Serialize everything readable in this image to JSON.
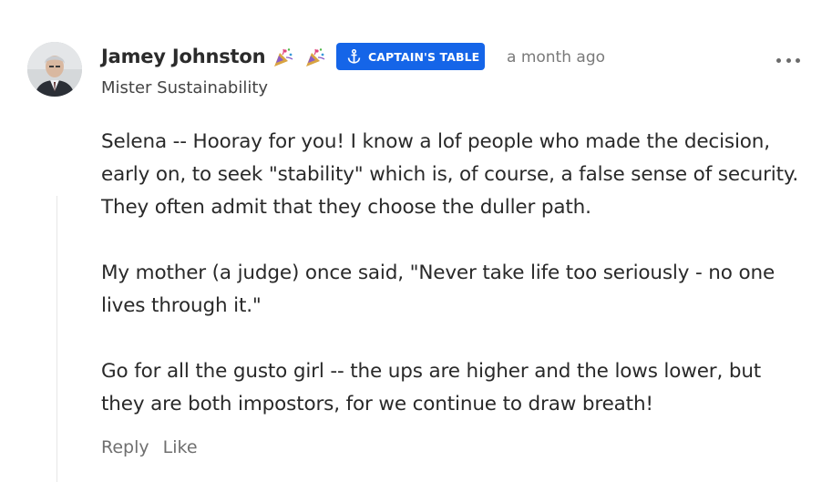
{
  "comment": {
    "author": "Jamey Johnston",
    "author_title": "Mister Sustainability",
    "badge_emojis": [
      "party-popper-icon",
      "party-popper-icon"
    ],
    "badge": {
      "label": "CAPTAIN'S TABLE",
      "icon": "anchor-icon",
      "color": "#1565e8"
    },
    "timestamp": "a month ago",
    "paragraphs": [
      "Selena -- Hooray for you! I know a lof people who made the decision, early on, to seek \"stability\" which is, of course, a false sense of security. They often admit that they choose the duller path.",
      "My mother (a judge) once said, \"Never take life too seriously - no one lives through it.\"",
      "Go for all the gusto girl -- the ups are higher and the lows lower, but they are both impostors, for we continue to draw breath!"
    ],
    "actions": {
      "reply": "Reply",
      "like": "Like"
    }
  }
}
